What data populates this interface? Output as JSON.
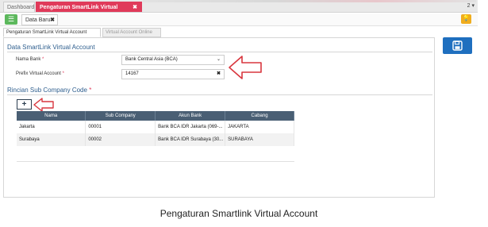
{
  "topbar": {
    "tabs": [
      {
        "label": "Dashboard"
      },
      {
        "label": "Pengaturan SmartLink Virtual Account",
        "close": "✖"
      }
    ],
    "right_label": "2 ▾"
  },
  "subbar": {
    "menu_icon": "list-icon",
    "tab_label": "Data Baru",
    "tab_close": "✖",
    "help_icon": "lightbulb-icon"
  },
  "content_tabs": [
    {
      "label": "Pengaturan SmartLink Virtual Account",
      "active": true
    },
    {
      "label": "Virtual Account Online",
      "active": false
    }
  ],
  "section1": {
    "title": "Data SmartLink Virtual Account",
    "fields": {
      "bank_label": "Nama Bank",
      "bank_required": "*",
      "bank_value": "Bank Central Asia (BCA)",
      "prefix_label": "Prefix Virtual Account",
      "prefix_required": "*",
      "prefix_value": "14167"
    }
  },
  "section2": {
    "title": "Rincian Sub Company Code",
    "required": "*",
    "add_label": "+",
    "table": {
      "columns": [
        "Nama",
        "Sub Company",
        "Akun Bank",
        "Cabang"
      ],
      "rows": [
        [
          "Jakarta",
          "00001",
          "Bank BCA IDR Jakarta (069-...",
          "JAKARTA"
        ],
        [
          "Surabaya",
          "00002",
          "Bank BCA IDR Surabaya (30...",
          "SURABAYA"
        ]
      ]
    }
  },
  "save_icon": "floppy-disk-icon",
  "caption": "Pengaturan Smartlink Virtual Account",
  "colors": {
    "active_tab": "#e03a5a",
    "menu_green": "#5cb85c",
    "save_blue": "#1f6fbf",
    "header_dark": "#4a5f74",
    "annotation_red": "#d9363e"
  }
}
